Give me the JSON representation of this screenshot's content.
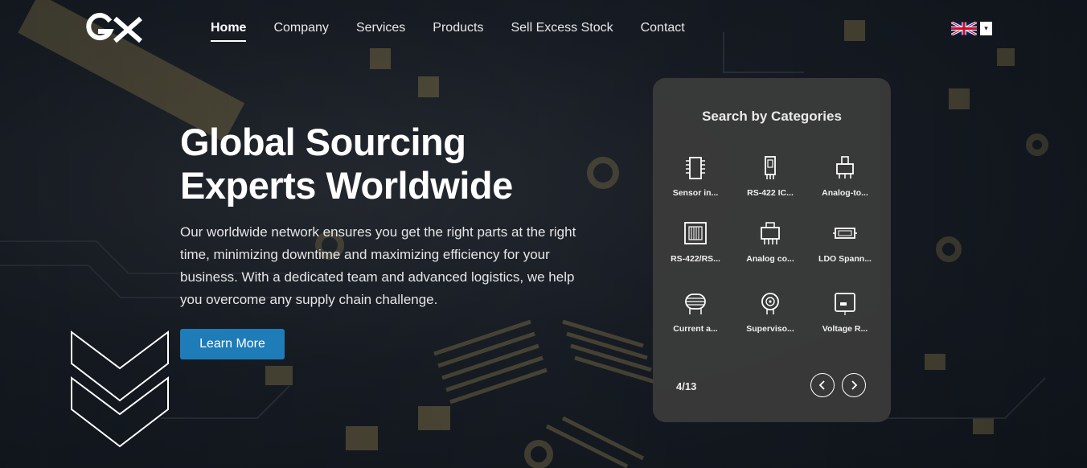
{
  "brand": {
    "logo_icon": "gx-logo"
  },
  "nav": {
    "items": [
      {
        "label": "Home",
        "active": true
      },
      {
        "label": "Company"
      },
      {
        "label": "Services"
      },
      {
        "label": "Products"
      },
      {
        "label": "Sell Excess Stock"
      },
      {
        "label": "Contact"
      }
    ]
  },
  "language": {
    "flag_icon": "uk-flag-icon",
    "caret": "▾"
  },
  "hero": {
    "title_line1": "Global Sourcing",
    "title_line2": "Experts Worldwide",
    "text": "Our worldwide network ensures you get the right parts at the right time, minimizing downtime and maximizing efficiency for your business. With a dedicated team and advanced logistics, we help you overcome any supply chain challenge.",
    "button_label": "Learn More"
  },
  "categories": {
    "title": "Search by Categories",
    "items": [
      {
        "label": "Sensor in...",
        "icon": "chip-icon"
      },
      {
        "label": "RS-422 IC...",
        "icon": "ic-package-icon"
      },
      {
        "label": "Analog-to...",
        "icon": "connector-icon"
      },
      {
        "label": "RS-422/RS...",
        "icon": "transceiver-icon"
      },
      {
        "label": "Analog co...",
        "icon": "comparator-icon"
      },
      {
        "label": "LDO Spann...",
        "icon": "regulator-icon"
      },
      {
        "label": "Current a...",
        "icon": "coil-icon"
      },
      {
        "label": "Superviso...",
        "icon": "supervisor-icon"
      },
      {
        "label": "Voltage R...",
        "icon": "voltage-regulator-icon"
      }
    ],
    "page": "4/13"
  },
  "colors": {
    "accent": "#1e7db8",
    "panel": "#3a3a3a"
  }
}
